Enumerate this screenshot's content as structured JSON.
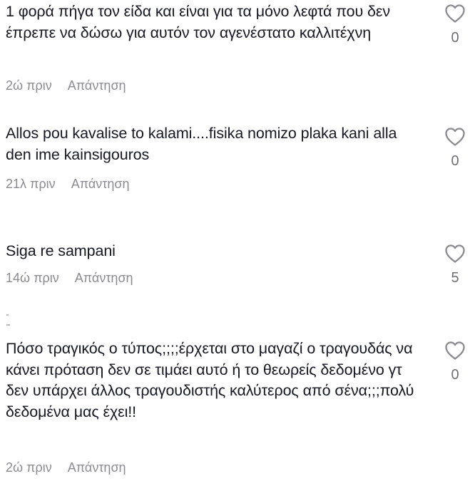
{
  "comments": [
    {
      "text": "1 φορά πήγα τον είδα και είναι για τα μόνο λεφτά που δεν έπρεπε να δώσω για αυτόν τον αγενέστατο καλλιτέχνη",
      "time": "2ώ πριν",
      "reply_label": "Απάντηση",
      "likes": "0"
    },
    {
      "text": "Allos pou kavalise to kalami....fisika nomizo plaka kani alla den ime kainsigouros",
      "time": "21λ πριν",
      "reply_label": "Απάντηση",
      "likes": "0"
    },
    {
      "text": "Siga re sampani",
      "time": "14ώ πριν",
      "reply_label": "Απάντηση",
      "likes": "5"
    },
    {
      "text": "Πόσο τραγικός ο τύπος;;;;έρχεται στο μαγαζί ο τραγουδάς να κάνει πρόταση δεν σε τιμάει αυτό ή το θεωρείς δεδομένο γτ δεν υπάρχει άλλος τραγουδιστής καλύτερος από σένα;;;πολύ δεδομένα μας έχει!!",
      "time": "2ώ πριν",
      "reply_label": "Απάντηση",
      "likes": "0"
    }
  ],
  "icons": {
    "like": "heart-outline-icon"
  },
  "colors": {
    "text": "#161823",
    "meta": "#8a8b91",
    "count": "#6f7077",
    "icon": "#8a8b91"
  }
}
